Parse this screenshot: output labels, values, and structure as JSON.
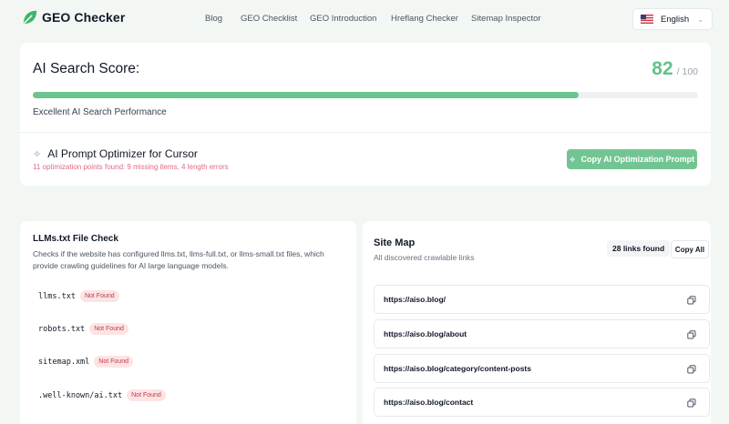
{
  "header": {
    "app_name": "GEO Checker",
    "nav": [
      "Blog",
      "GEO Checklist",
      "GEO Introduction",
      "Hreflang Checker",
      "Sitemap Inspector"
    ],
    "language": "English"
  },
  "score": {
    "title": "AI Search Score:",
    "value": "82",
    "max": "/ 100",
    "progress_fraction": 0.82,
    "status": "Excellent AI Search Performance",
    "accent_color": "#5ec48a"
  },
  "optimizer": {
    "title": "AI Prompt Optimizer for Cursor",
    "summary": "11 optimization points found: 9 missing items, 4 length errors",
    "button": "Copy AI Optimization Prompt",
    "button_icon": "sparkle-icon"
  },
  "llms": {
    "title": "LLMs.txt File Check",
    "description": "Checks if the website has configured llms.txt, llms-full.txt, or llms-small.txt files, which provide crawling guidelines for AI large language models.",
    "files": [
      {
        "name": "llms.txt",
        "status": "Not Found"
      },
      {
        "name": "robots.txt",
        "status": "Not Found"
      },
      {
        "name": "sitemap.xml",
        "status": "Not Found"
      },
      {
        "name": ".well-known/ai.txt",
        "status": "Not Found"
      }
    ]
  },
  "sitemap": {
    "title": "Site Map",
    "subtitle": "All discovered crawlable links",
    "count": "28 links found",
    "copy_all": "Copy All",
    "links": [
      "https://aiso.blog/",
      "https://aiso.blog/about",
      "https://aiso.blog/category/content-posts",
      "https://aiso.blog/contact"
    ]
  }
}
